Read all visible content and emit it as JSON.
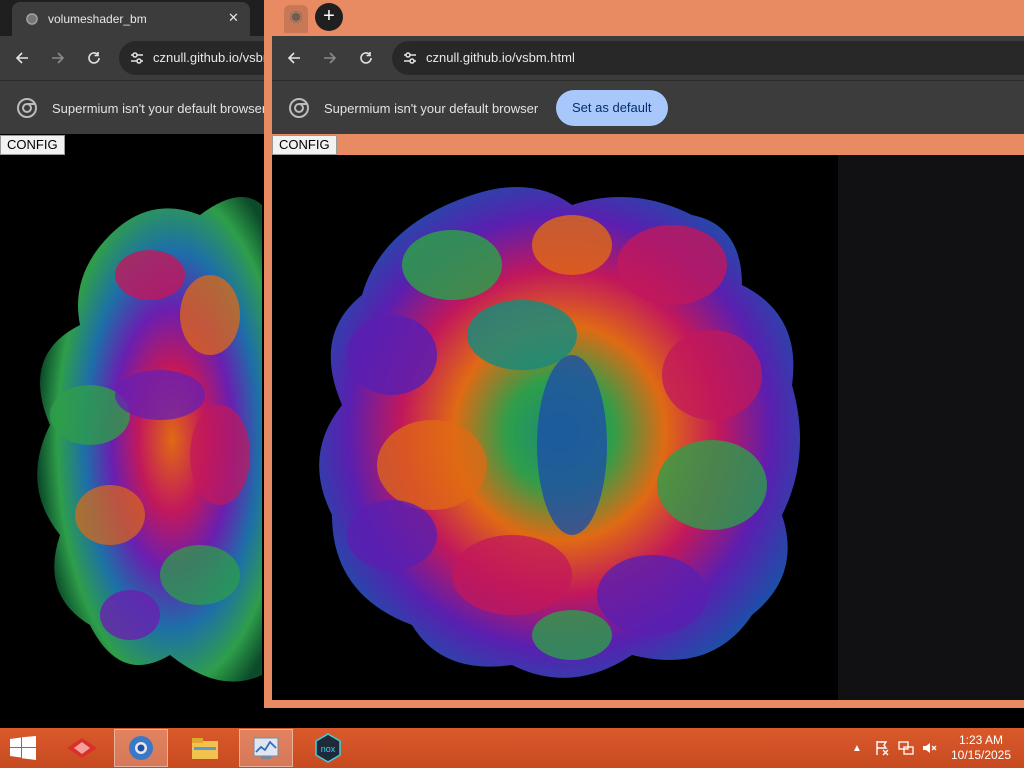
{
  "back_window": {
    "tab": {
      "title": "volumeshader_bm",
      "close_glyph": "✕"
    },
    "url": "cznull.github.io/vsbm.html",
    "infobar_message": "Supermium isn't your default browser",
    "config_label": "CONFIG"
  },
  "front_window": {
    "new_tab_glyph": "+",
    "url": "cznull.github.io/vsbm.html",
    "infobar_message": "Supermium isn't your default browser",
    "set_default_label": "Set as default",
    "config_label": "CONFIG",
    "frame_color": "#e88a62"
  },
  "nav": {
    "back": "←",
    "forward": "→",
    "reload": "↻"
  },
  "taskbar": {
    "apps": [
      "start-menu-icon",
      "red-app-icon",
      "supermium-browser-icon",
      "file-explorer-icon",
      "task-manager-icon",
      "nox-player-icon"
    ],
    "tray": {
      "chevron": "▲"
    },
    "clock": {
      "time": "1:23 AM",
      "date": "10/15/2025"
    },
    "color": "#d0522a"
  }
}
